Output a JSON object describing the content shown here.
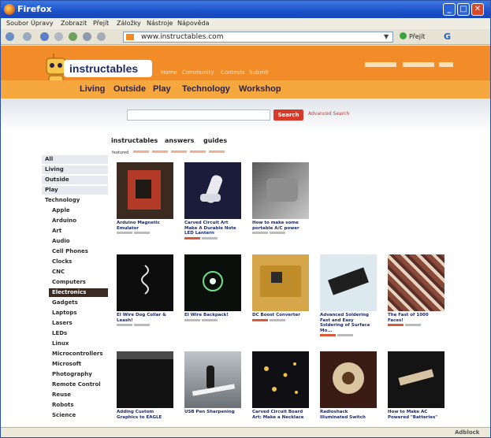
{
  "window": {
    "title": "Firefox"
  },
  "menu": [
    "Soubor",
    "Úpravy",
    "Zobrazit",
    "Přejít",
    "Záložky",
    "Nástroje",
    "Nápověda"
  ],
  "nav": {
    "url": "www.instructables.com",
    "go_label": "Přejít"
  },
  "site": {
    "logo": "instructables",
    "top_links": [
      "Home",
      "Community",
      "Contests",
      "Submit"
    ],
    "categories": [
      "Living",
      "Outside",
      "Play",
      "Technology",
      "Workshop"
    ],
    "search_button": "Search",
    "advanced_search": "Advanced Search",
    "tabs": [
      "instructables",
      "answers",
      "guides"
    ],
    "filter_label": "featured"
  },
  "sidebar": {
    "items": [
      "All",
      "Living",
      "Outside",
      "Play",
      "Technology"
    ],
    "subitems": [
      "Apple",
      "Arduino",
      "Art",
      "Audio",
      "Cell Phones",
      "Clocks",
      "CNC",
      "Computers",
      "Electronics",
      "Gadgets",
      "Laptops",
      "Lasers",
      "LEDs",
      "Linux",
      "Microcontrollers",
      "Microsoft",
      "Photography",
      "Remote Control",
      "Reuse",
      "Robots",
      "Science"
    ],
    "active": "Electronics"
  },
  "cards": [
    {
      "title": "Arduino Magnetic Emulator",
      "thumb": "red-board"
    },
    {
      "title": "Carved Circuit Art Make A Durable Note LED Lantern",
      "thumb": "dark-hand"
    },
    {
      "title": "How to make some portable A/C power",
      "thumb": "gray-gadget"
    },
    {
      "title": "EI Wire Dog Collar & Leash!",
      "thumb": "wire-dark"
    },
    {
      "title": "EI Wire Backpack!",
      "thumb": "ring-dark"
    },
    {
      "title": "DC Boost Converter",
      "thumb": "yellow-board"
    },
    {
      "title": "Advanced Soldering Fast and Easy Soldering of Surface Mo...",
      "thumb": "chips"
    },
    {
      "title": "The Fast of 1000 Faces!",
      "thumb": "collage"
    },
    {
      "title": "Adding Custom Graphics to EAGLE",
      "thumb": "eagle-black"
    },
    {
      "title": "USB Pen Sharpening",
      "thumb": "bird-gray"
    },
    {
      "title": "Carved Circuit Board Art: Make a Necklace",
      "thumb": "dots-dark"
    },
    {
      "title": "Radioshack Illuminated Switch",
      "thumb": "switch"
    },
    {
      "title": "How to Make AC Powered \"Batteries\"",
      "thumb": "batteries"
    }
  ],
  "status_right": "Adblock"
}
